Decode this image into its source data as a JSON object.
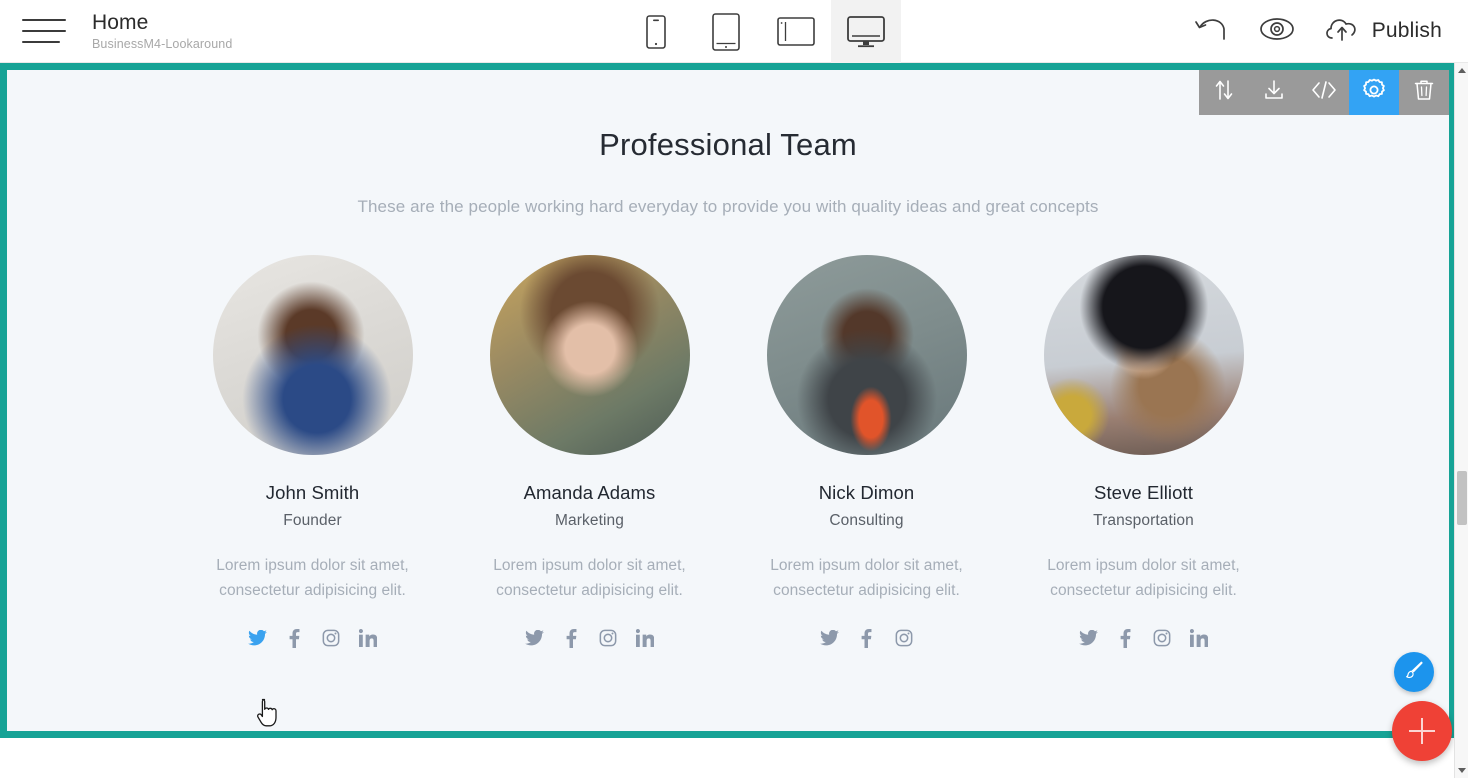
{
  "topbar": {
    "menu_icon": "hamburger-icon",
    "page_title": "Home",
    "project_name": "BusinessM4-Lookaround",
    "devices": [
      {
        "id": "mobile",
        "icon": "mobile-phone-icon",
        "active": false
      },
      {
        "id": "tablet-portrait",
        "icon": "tablet-portrait-icon",
        "active": false
      },
      {
        "id": "tablet-landscape",
        "icon": "tablet-landscape-icon",
        "active": false
      },
      {
        "id": "desktop",
        "icon": "desktop-monitor-icon",
        "active": true
      }
    ],
    "undo_icon": "undo-arrow-icon",
    "preview_icon": "eye-preview-icon",
    "publish_icon": "cloud-upload-icon",
    "publish_label": "Publish"
  },
  "block_toolbar": {
    "items": [
      {
        "id": "move",
        "icon": "move-up-down-icon",
        "active": false
      },
      {
        "id": "download",
        "icon": "download-icon",
        "active": false
      },
      {
        "id": "code",
        "icon": "code-brackets-icon",
        "active": false
      },
      {
        "id": "settings",
        "icon": "gear-icon",
        "active": true
      },
      {
        "id": "delete",
        "icon": "trash-icon",
        "active": false
      }
    ]
  },
  "block": {
    "title": "Professional Team",
    "subtitle": "These are the people working hard everyday to provide you with quality  ideas  and great concepts",
    "members": [
      {
        "name": "John Smith",
        "role": "Founder",
        "description": "Lorem ipsum dolor sit amet, consectetur adipisicing elit.",
        "avatar_alt": "portrait-man-blue-blazer",
        "socials": [
          {
            "id": "twitter",
            "icon": "twitter-icon",
            "highlighted": true
          },
          {
            "id": "facebook",
            "icon": "facebook-icon",
            "highlighted": false
          },
          {
            "id": "instagram",
            "icon": "instagram-icon",
            "highlighted": false
          },
          {
            "id": "linkedin",
            "icon": "linkedin-icon",
            "highlighted": false
          }
        ]
      },
      {
        "name": "Amanda Adams",
        "role": "Marketing",
        "description": "Lorem ipsum dolor sit amet, consectetur adipisicing elit.",
        "avatar_alt": "portrait-woman-long-hair",
        "socials": [
          {
            "id": "twitter",
            "icon": "twitter-icon",
            "highlighted": false
          },
          {
            "id": "facebook",
            "icon": "facebook-icon",
            "highlighted": false
          },
          {
            "id": "instagram",
            "icon": "instagram-icon",
            "highlighted": false
          },
          {
            "id": "linkedin",
            "icon": "linkedin-icon",
            "highlighted": false
          }
        ]
      },
      {
        "name": "Nick Dimon",
        "role": "Consulting",
        "description": "Lorem ipsum dolor sit amet, consectetur adipisicing elit.",
        "avatar_alt": "portrait-man-vest-orange-tie",
        "socials": [
          {
            "id": "twitter",
            "icon": "twitter-icon",
            "highlighted": false
          },
          {
            "id": "facebook",
            "icon": "facebook-icon",
            "highlighted": false
          },
          {
            "id": "instagram",
            "icon": "instagram-icon",
            "highlighted": false
          }
        ]
      },
      {
        "name": "Steve Elliott",
        "role": "Transportation",
        "description": "Lorem ipsum dolor sit amet, consectetur adipisicing elit.",
        "avatar_alt": "portrait-woman-black-hat",
        "socials": [
          {
            "id": "twitter",
            "icon": "twitter-icon",
            "highlighted": false
          },
          {
            "id": "facebook",
            "icon": "facebook-icon",
            "highlighted": false
          },
          {
            "id": "instagram",
            "icon": "instagram-icon",
            "highlighted": false
          },
          {
            "id": "linkedin",
            "icon": "linkedin-icon",
            "highlighted": false
          }
        ]
      }
    ]
  },
  "floating": {
    "brush_icon": "paintbrush-icon",
    "add_icon": "plus-icon"
  },
  "colors": {
    "accent_teal": "#16a396",
    "block_bg": "#f4f7fa",
    "toolbar_gray": "#9a9a9a",
    "toolbar_active_blue": "#33a3f4",
    "fab_blue": "#1c94ed",
    "fab_red": "#ef4136",
    "social_gray": "#8d99ab",
    "social_highlight": "#3aa2ef"
  }
}
